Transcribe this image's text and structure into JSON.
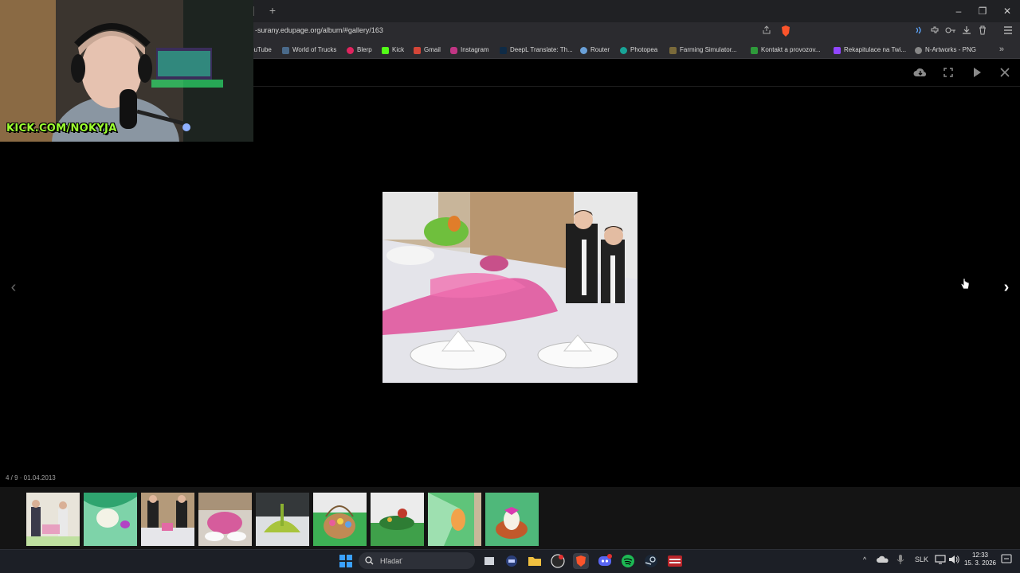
{
  "browser": {
    "new_tab_symbol": "+",
    "window_controls": {
      "minimize": "–",
      "restore": "❐",
      "close": "✕"
    },
    "url": "-surany.edupage.org/album/#gallery/163",
    "bookmarks": [
      {
        "label": "ouTube",
        "color": "#ff0000"
      },
      {
        "label": "World of Trucks",
        "color": "#4a6a8a"
      },
      {
        "label": "Blerp",
        "color": "#e0245e"
      },
      {
        "label": "Kick",
        "color": "#53fc18"
      },
      {
        "label": "Gmail",
        "color": "#d44638"
      },
      {
        "label": "Instagram",
        "color": "#c13584"
      },
      {
        "label": "DeepL Translate: Th...",
        "color": "#0f2b46"
      },
      {
        "label": "Router",
        "color": "#6aa0d8"
      },
      {
        "label": "Photopea",
        "color": "#18a497"
      },
      {
        "label": "Farming Simulator...",
        "color": "#7a6a3a"
      },
      {
        "label": "Kontakt a provozov...",
        "color": "#2e9a3a"
      },
      {
        "label": "Rekapitulace na Twi...",
        "color": "#9146ff"
      },
      {
        "label": "N-Artworks - PNG",
        "color": "#888888"
      }
    ],
    "bookmarks_overflow": "»"
  },
  "viewer": {
    "tools": {
      "download_icon": "cloud-download-icon",
      "fullscreen_icon": "fullscreen-icon",
      "slideshow_icon": "play-icon",
      "close_icon": "close-icon"
    },
    "nav": {
      "prev": "‹",
      "next": "›"
    },
    "counter": "4 / 9 · 01.04.2013",
    "thumbnails_count": 9
  },
  "webcam": {
    "label": "KICK.COM/NOKYJA"
  },
  "taskbar": {
    "search_placeholder": "Hľadať",
    "language": "SLK",
    "time": "12:33",
    "date": "15. 3. 2026",
    "tray_expand": "^"
  }
}
